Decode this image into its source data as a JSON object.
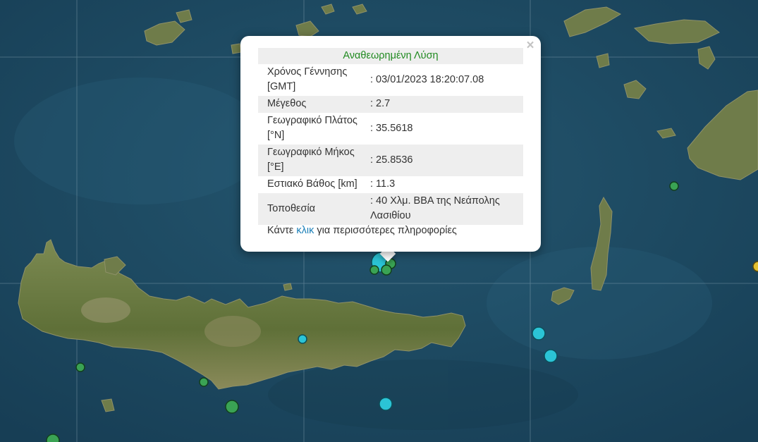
{
  "popup": {
    "title": "Αναθεωρημένη Λύση",
    "close_glyph": "×",
    "rows": [
      {
        "label": "Χρόνος Γέννησης [GMT]",
        "value": ": 03/01/2023 18:20:07.08"
      },
      {
        "label": "Μέγεθος",
        "value": ": 2.7"
      },
      {
        "label": "Γεωγραφικό Πλάτος [°N]",
        "value": ": 35.5618"
      },
      {
        "label": "Γεωγραφικό Μήκος [°E]",
        "value": ": 25.8536"
      },
      {
        "label": "Εστιακό Βάθος [km]",
        "value": ": 11.3"
      },
      {
        "label": "Τοποθεσία",
        "value": ": 40 Χλμ. ΒΒΑ της Νεάπολης Λασιθίου"
      }
    ],
    "footer_prefix": "Κάντε ",
    "footer_link": "κλικ",
    "footer_suffix": " για περισσότερες πληροφορίες"
  },
  "colors": {
    "sea": "#1d4a62",
    "land": "#6b7a45",
    "marker_green": "#3aa354",
    "marker_cyan": "#2bc4d6",
    "marker_yellow": "#e3c030",
    "title_green": "#208a20",
    "link_blue": "#1b7fb8"
  },
  "markers": [
    {
      "kind": "recent",
      "color": "cyan"
    },
    {
      "kind": "older",
      "color": "green"
    }
  ]
}
